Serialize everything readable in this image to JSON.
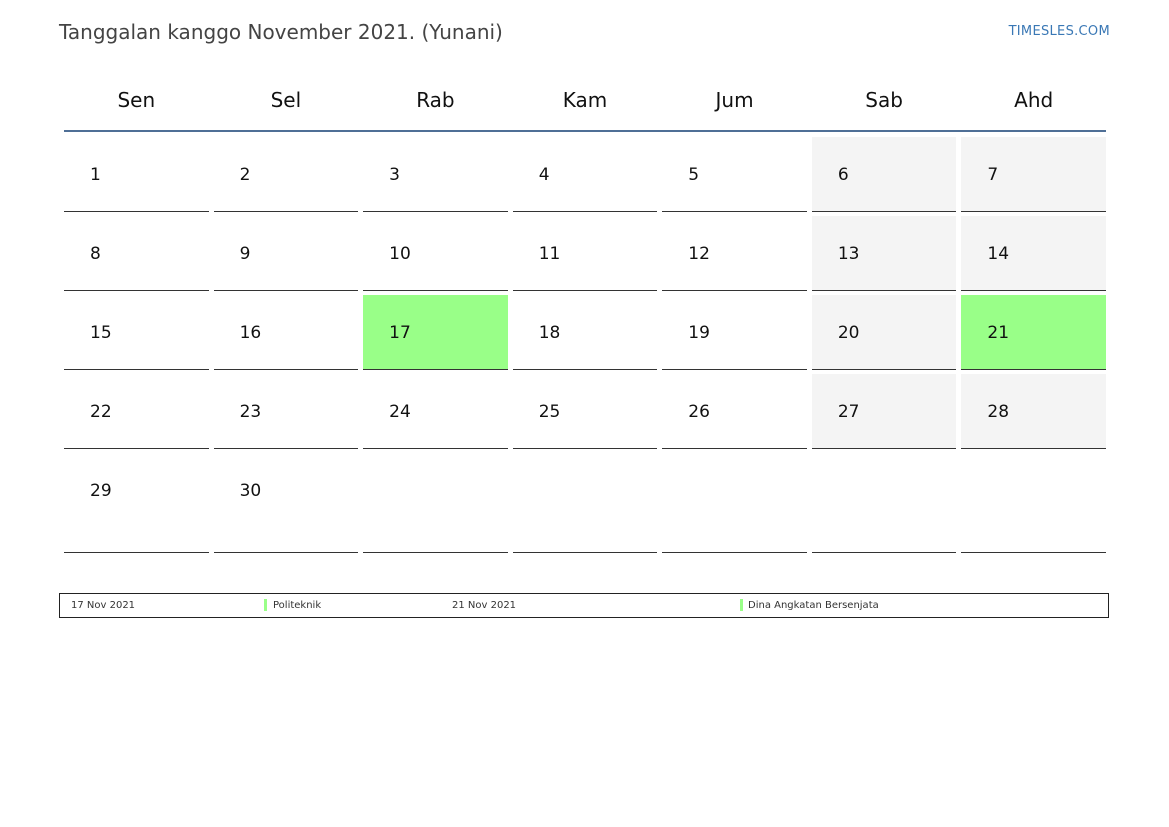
{
  "header": {
    "title": "Tanggalan kanggo November 2021. (Yunani)",
    "brand": "TIMESLES.COM"
  },
  "calendar": {
    "weekdays": [
      "Sen",
      "Sel",
      "Rab",
      "Kam",
      "Jum",
      "Sab",
      "Ahd"
    ],
    "weeks": [
      [
        "1",
        "2",
        "3",
        "4",
        "5",
        "6",
        "7"
      ],
      [
        "8",
        "9",
        "10",
        "11",
        "12",
        "13",
        "14"
      ],
      [
        "15",
        "16",
        "17",
        "18",
        "19",
        "20",
        "21"
      ],
      [
        "22",
        "23",
        "24",
        "25",
        "26",
        "27",
        "28"
      ],
      [
        "29",
        "30",
        "",
        "",
        "",
        "",
        ""
      ]
    ],
    "holiday_days": [
      "17",
      "21"
    ],
    "colors": {
      "holiday": "#99ff88",
      "weekend": "#f4f4f4",
      "header_rule": "#4f6f96",
      "brand": "#3a78b5"
    }
  },
  "legend": {
    "items": [
      {
        "date": "17 Nov 2021",
        "name": "Politeknik"
      },
      {
        "date": "21 Nov 2021",
        "name": "Dina Angkatan Bersenjata"
      }
    ]
  }
}
